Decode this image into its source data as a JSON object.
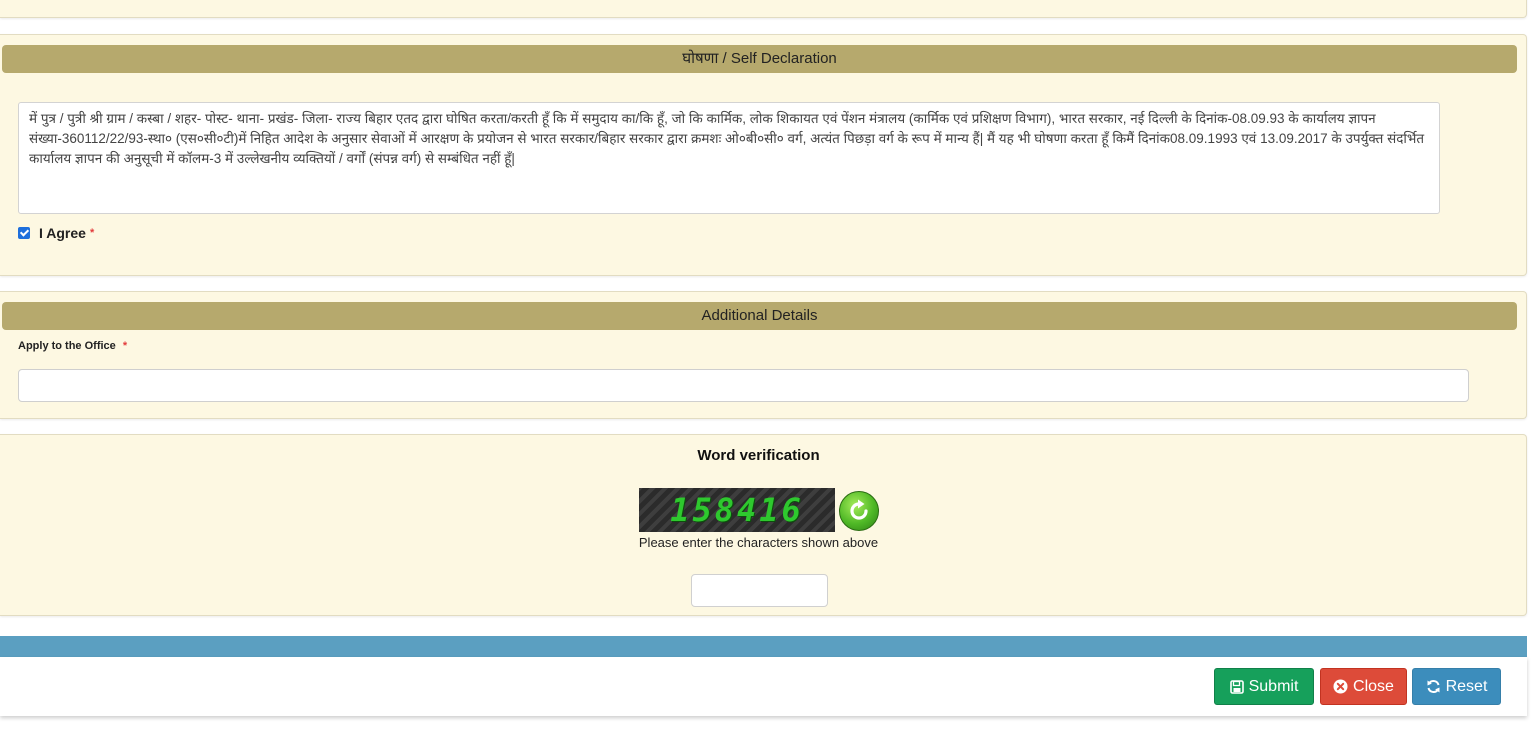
{
  "self_declaration": {
    "header": "घोषणा / Self Declaration",
    "text": "में   पुत्र / पुत्री श्री   ग्राम / कस्बा / शहर-  पोस्ट-  थाना-  प्रखंड-  जिला-  राज्य बिहार एतद द्वारा घोषित करता/करती हूँ कि  में   समुदाय का/कि हूँ, जो कि कार्मिक, लोक शिकायत एवं पेंशन मंत्रालय (कार्मिक एवं प्रशिक्षण विभाग), भारत सरकार, नई  दिल्ली के दिनांक-08.09.93 के कार्यालय ज्ञापन संख्या-360112/22/93-स्था० (एस०सी०टी)में निहित आदेश के अनुसार सेवाओं में आरक्षण के प्रयोजन से भारत सरकार/बिहार सरकार द्वारा क्रमशः ओ०बी०सी० वर्ग, अत्यंत पिछड़ा वर्ग के रूप में मान्य हैं|  मैं यह भी घोषणा करता हूँ किमैं दिनांक08.09.1993 एवं 13.09.2017 के उपर्युक्त संदर्भित कार्यालय ज्ञापन की अनुसूची में कॉलम-3 में उल्लेखनीय व्यक्तियों / वर्गों (संपन्न वर्ग) से सम्बंधित नहीं हूँ|",
    "agree_label": "I Agree",
    "agree_checked": true,
    "required_marker": "*"
  },
  "additional_details": {
    "header": "Additional Details",
    "office_label": "Apply to the Office",
    "required_marker": "*",
    "office_value": ""
  },
  "word_verification": {
    "title": "Word verification",
    "captcha_text": "158416",
    "hint": "Please enter the characters shown above",
    "input_value": "",
    "refresh_icon": "refresh-icon"
  },
  "footer": {
    "submit_label": "Submit",
    "close_label": "Close",
    "reset_label": "Reset",
    "colors": {
      "submit": "#16a05b",
      "close": "#dd4b39",
      "reset": "#3c8dbc",
      "bar": "#5b9fc1",
      "section_header": "#b6a96d",
      "panel": "#fdf8e2"
    }
  }
}
